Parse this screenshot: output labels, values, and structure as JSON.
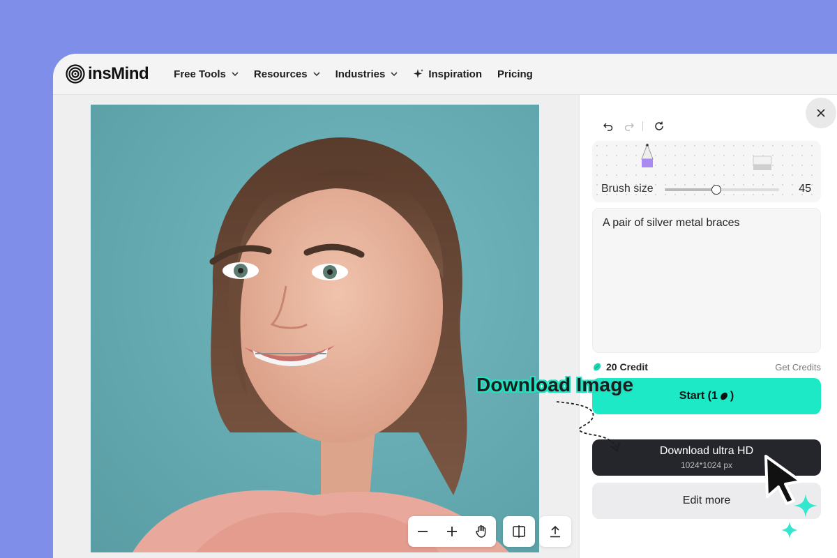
{
  "brand": {
    "name": "insMind"
  },
  "nav": {
    "free_tools": "Free Tools",
    "resources": "Resources",
    "industries": "Industries",
    "inspiration": "Inspiration",
    "pricing": "Pricing"
  },
  "brush": {
    "label": "Brush size",
    "value": "45",
    "level_fraction": 0.45
  },
  "prompt": {
    "text": "A pair of silver metal braces"
  },
  "credits": {
    "amount": "20 Credit",
    "get_label": "Get Credits"
  },
  "actions": {
    "start_label": "Start (1",
    "start_suffix": ")",
    "download_label": "Download ultra HD",
    "download_size": "1024*1024 px",
    "edit_label": "Edit more"
  },
  "callout": {
    "text": "Download Image"
  },
  "colors": {
    "accent": "#1de9c7",
    "dark_button": "#24262b",
    "background": "#7f8fe9"
  },
  "icons": [
    "close-icon",
    "undo-icon",
    "redo-icon",
    "refresh-icon",
    "pencil-icon",
    "eraser-icon",
    "minus-icon",
    "plus-icon",
    "hand-icon",
    "compare-icon",
    "upload-icon",
    "bean-icon",
    "cursor-icon",
    "sparkle-icon"
  ]
}
